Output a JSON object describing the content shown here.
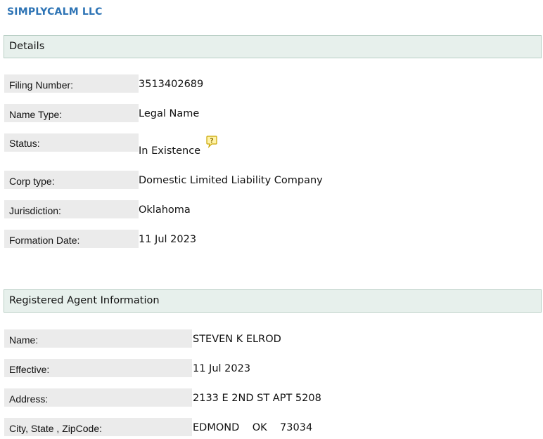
{
  "company": {
    "name": "SIMPLYCALM LLC"
  },
  "details": {
    "header": "Details",
    "rows": [
      {
        "label": "Filing Number:",
        "value": "3513402689"
      },
      {
        "label": "Name Type:",
        "value": "Legal Name"
      },
      {
        "label": "Status:",
        "value": "In Existence"
      },
      {
        "label": "Corp type:",
        "value": "Domestic Limited Liability Company"
      },
      {
        "label": "Jurisdiction:",
        "value": "Oklahoma"
      },
      {
        "label": "Formation Date:",
        "value": "11 Jul 2023"
      }
    ],
    "status_icon": "note-icon"
  },
  "agent": {
    "header": "Registered Agent Information",
    "rows": [
      {
        "label": "Name:",
        "value": "STEVEN K ELROD"
      },
      {
        "label": "Effective:",
        "value": "11 Jul 2023"
      },
      {
        "label": "Address:",
        "value": "2133 E 2ND ST APT 5208"
      },
      {
        "label": "City, State , ZipCode:",
        "value": "EDMOND    OK    73034"
      }
    ]
  },
  "colors": {
    "title": "#2e74b5",
    "header_bg": "#e7f0ec",
    "label_bg": "#ebebeb"
  }
}
